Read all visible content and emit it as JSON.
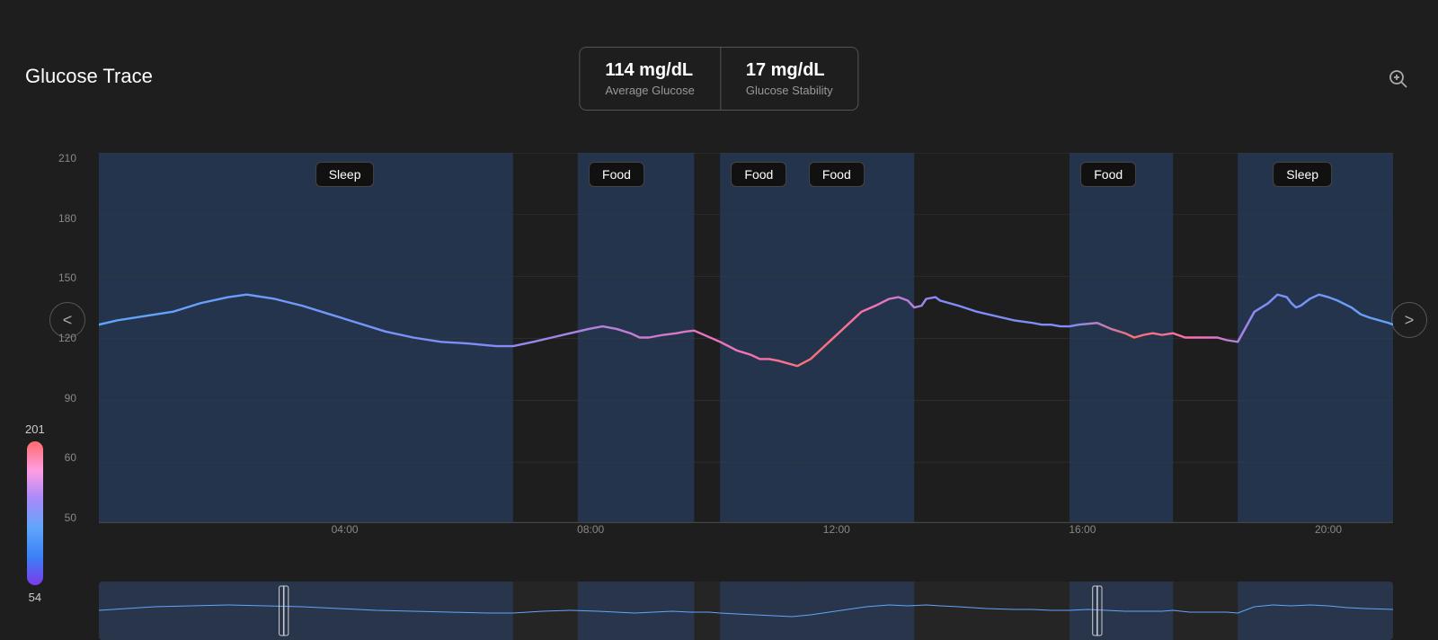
{
  "title": "Glucose Trace",
  "stats": {
    "average_glucose_value": "114 mg/dL",
    "average_glucose_label": "Average Glucose",
    "stability_value": "17 mg/dL",
    "stability_label": "Glucose Stability"
  },
  "scale": {
    "top_value": "201",
    "bottom_value": "54"
  },
  "annotations": [
    {
      "label": "Sleep",
      "x_pct": 19
    },
    {
      "label": "Food",
      "x_pct": 40
    },
    {
      "label": "Food",
      "x_pct": 51
    },
    {
      "label": "Food",
      "x_pct": 57
    },
    {
      "label": "Food",
      "x_pct": 78
    },
    {
      "label": "Sleep",
      "x_pct": 92
    }
  ],
  "bands": [
    {
      "start_pct": 0,
      "end_pct": 32,
      "type": "sleep"
    },
    {
      "start_pct": 37,
      "end_pct": 46,
      "type": "food"
    },
    {
      "start_pct": 48,
      "end_pct": 54,
      "type": "food"
    },
    {
      "start_pct": 54,
      "end_pct": 63,
      "type": "food"
    },
    {
      "start_pct": 75,
      "end_pct": 83,
      "type": "food"
    },
    {
      "start_pct": 88,
      "end_pct": 100,
      "type": "sleep"
    }
  ],
  "y_labels": [
    "210",
    "180",
    "150",
    "120",
    "90",
    "60",
    "50"
  ],
  "x_labels": [
    "04:00",
    "08:00",
    "12:00",
    "16:00",
    "20:00"
  ],
  "x_label_pcts": [
    19,
    38,
    57,
    76,
    95
  ],
  "nav": {
    "left_label": "<",
    "right_label": ">"
  },
  "zoom_icon": "⊕"
}
